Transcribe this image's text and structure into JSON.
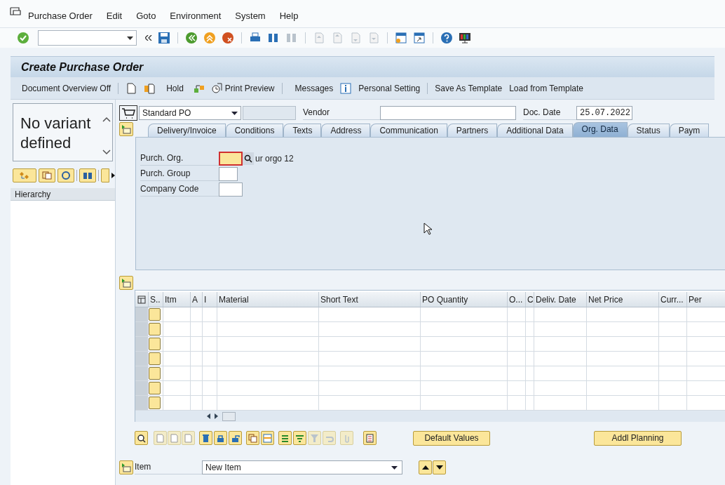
{
  "menu_bar": {
    "items": [
      {
        "label": "Purchase Order"
      },
      {
        "label": "Edit"
      },
      {
        "label": "Goto"
      },
      {
        "label": "Environment"
      },
      {
        "label": "System"
      },
      {
        "label": "Help"
      }
    ]
  },
  "title": "Create Purchase Order",
  "app_toolbar": {
    "items": [
      {
        "kind": "text",
        "label": "Document Overview Off"
      },
      {
        "kind": "icon-text",
        "label": "Hold"
      },
      {
        "kind": "icon-text",
        "label": "Print Preview"
      },
      {
        "kind": "text",
        "label": "Messages"
      },
      {
        "kind": "icon-text",
        "label": "Personal Setting"
      },
      {
        "kind": "text",
        "label": "Save As Template"
      },
      {
        "kind": "text",
        "label": "Load from Template"
      }
    ]
  },
  "left_panel": {
    "variant_text": "No variant defined",
    "tree_header": "Hierarchy"
  },
  "header": {
    "doc_type": "Standard PO",
    "vendor_label": "Vendor",
    "doc_date_label": "Doc. Date",
    "doc_date": "25.07.2022"
  },
  "tabs": [
    {
      "label": "Delivery/Invoice",
      "selected": false
    },
    {
      "label": "Conditions",
      "selected": false
    },
    {
      "label": "Texts",
      "selected": false
    },
    {
      "label": "Address",
      "selected": false
    },
    {
      "label": "Communication",
      "selected": false
    },
    {
      "label": "Partners",
      "selected": false
    },
    {
      "label": "Additional Data",
      "selected": false
    },
    {
      "label": "Org. Data",
      "selected": true
    },
    {
      "label": "Status",
      "selected": false
    },
    {
      "label": "Paym",
      "selected": false
    }
  ],
  "org_fields": [
    {
      "label": "Purch. Org.",
      "focused": true,
      "tooltip": "ur orgo 12"
    },
    {
      "label": "Purch. Group",
      "focused": false
    },
    {
      "label": "Company Code",
      "focused": false
    }
  ],
  "items_table": {
    "columns": [
      "S..",
      "Itm",
      "A",
      "I",
      "Material",
      "Short Text",
      "PO Quantity",
      "O...",
      "C",
      "Deliv. Date",
      "Net Price",
      "Curr...",
      "Per"
    ]
  },
  "bottom_buttons": [
    {
      "label": "Default Values"
    },
    {
      "label": "Addl Planning"
    }
  ],
  "item_selector": {
    "label": "Item",
    "value": "New Item"
  }
}
